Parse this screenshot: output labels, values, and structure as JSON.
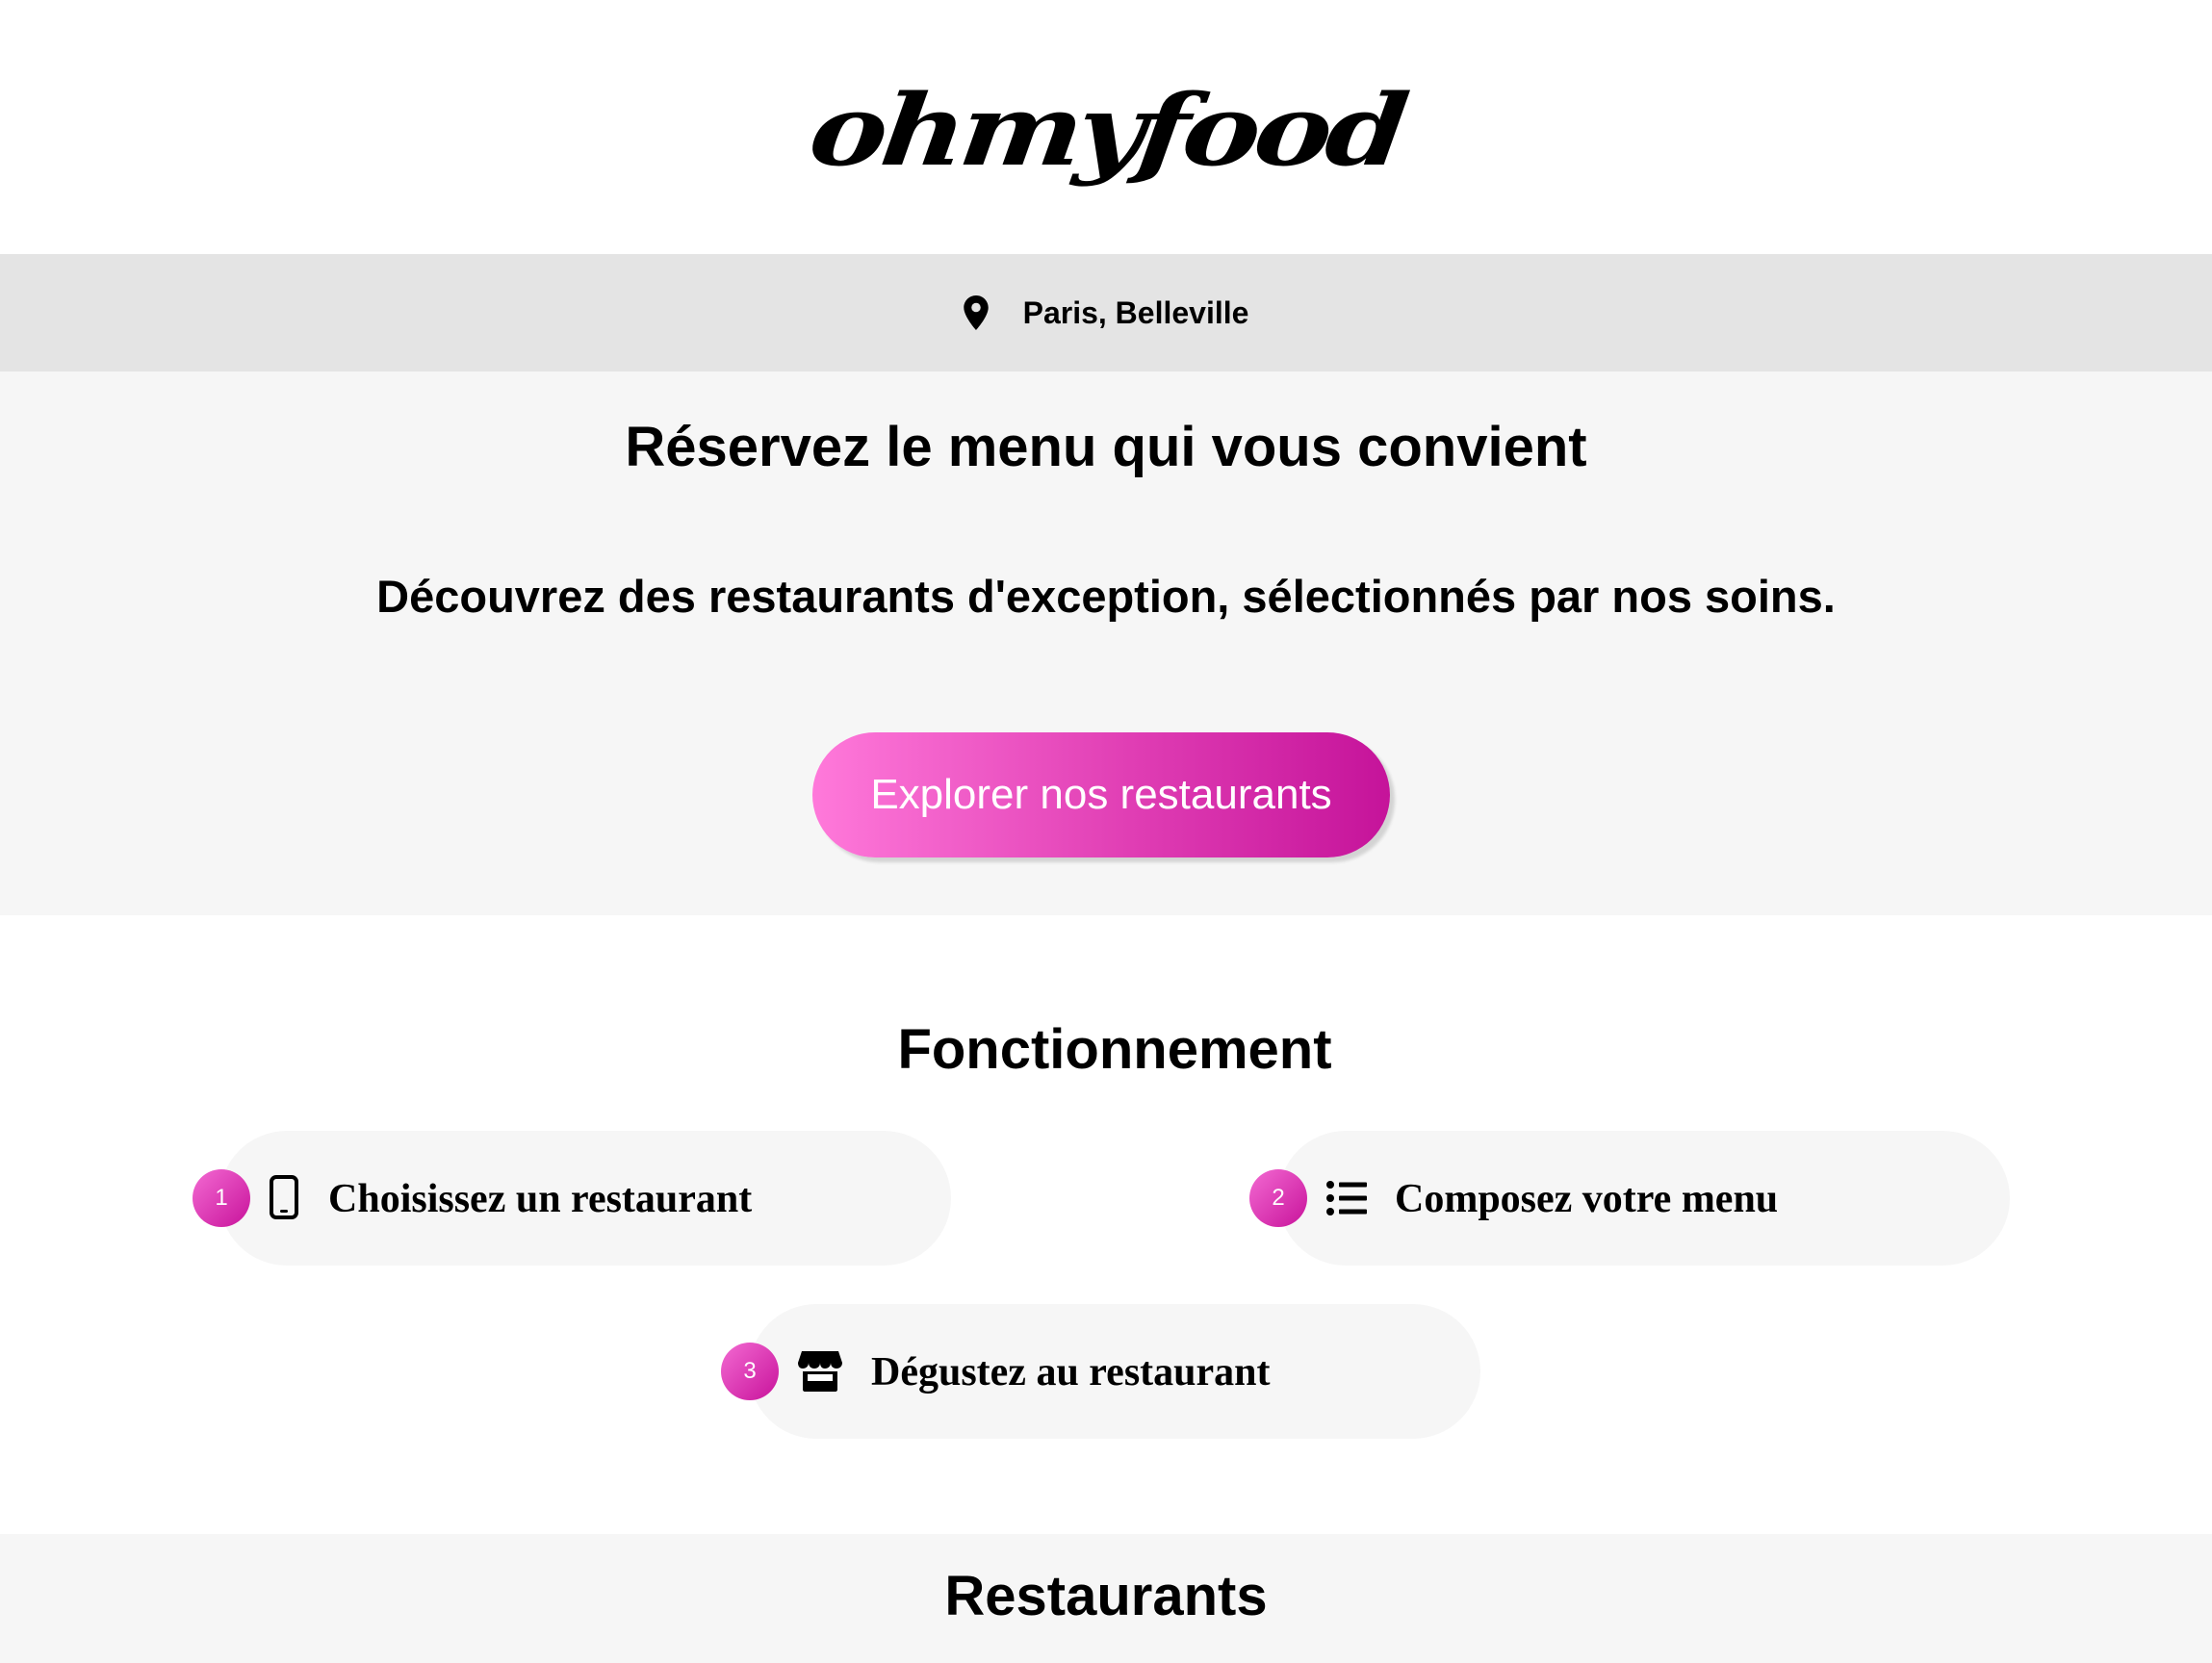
{
  "header": {
    "logo": "ohmyfood"
  },
  "location": {
    "icon": "map-pin-icon",
    "text": "Paris, Belleville"
  },
  "hero": {
    "title": "Réservez le menu qui vous convient",
    "subtitle": "Découvrez des restaurants d'exception, sélectionnés par nos soins.",
    "button_label": "Explorer nos restaurants",
    "button_gradient": [
      "#ff79da",
      "#c5139a"
    ]
  },
  "how_it_works": {
    "title": "Fonctionnement",
    "steps": [
      {
        "number": "1",
        "icon": "smartphone-icon",
        "label": "Choisissez un restaurant"
      },
      {
        "number": "2",
        "icon": "list-icon",
        "label": "Composez votre menu"
      },
      {
        "number": "3",
        "icon": "store-icon",
        "label": "Dégustez au restaurant"
      }
    ]
  },
  "restaurants": {
    "title": "Restaurants"
  },
  "colors": {
    "accent": "#c5139a",
    "accent_light": "#ff79da",
    "location_bar_bg": "#e4e4e4",
    "section_bg": "#f6f6f6"
  }
}
